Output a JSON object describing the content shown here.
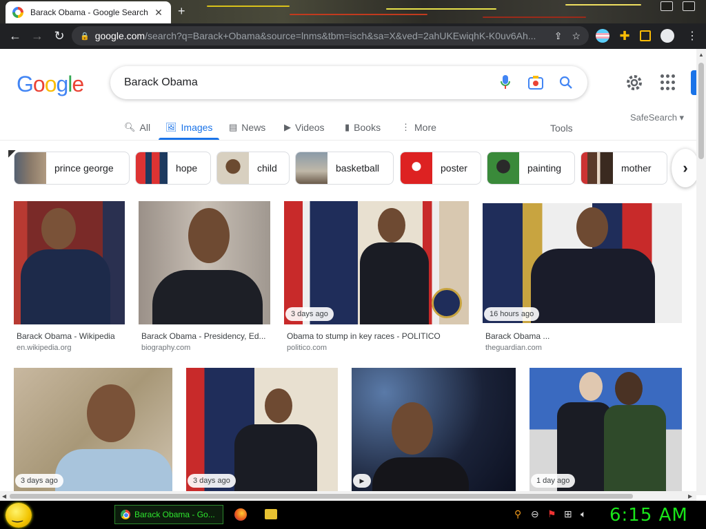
{
  "browser": {
    "tab_title": "Barack Obama - Google Search",
    "url_host": "google.com",
    "url_rest": "/search?q=Barack+Obama&source=lnms&tbm=isch&sa=X&ved=2ahUKEwiqhK-K0uv6Ah...",
    "tab_close": "✕",
    "new_tab": "+"
  },
  "google": {
    "logo": [
      "G",
      "o",
      "o",
      "g",
      "l",
      "e"
    ],
    "logo_colors": [
      "#4285f4",
      "#ea4335",
      "#fbbc05",
      "#4285f4",
      "#34a853",
      "#ea4335"
    ],
    "query": "Barack Obama",
    "tabs": [
      {
        "label": "All",
        "icon": "search-icon"
      },
      {
        "label": "Images",
        "icon": "image-icon",
        "active": true
      },
      {
        "label": "News",
        "icon": "news-icon"
      },
      {
        "label": "Videos",
        "icon": "video-icon"
      },
      {
        "label": "Books",
        "icon": "book-icon"
      },
      {
        "label": "More",
        "icon": "more-vert-icon"
      }
    ],
    "tools": "Tools",
    "safesearch": "SafeSearch ▾",
    "chips": [
      "prince george",
      "hope",
      "child",
      "basketball",
      "poster",
      "painting",
      "mother"
    ],
    "results": [
      {
        "title": "Barack Obama - Wikipedia",
        "source": "en.wikipedia.org",
        "badge": ""
      },
      {
        "title": "Barack Obama - Presidency, Ed...",
        "source": "biography.com",
        "badge": ""
      },
      {
        "title": "Obama to stump in key races - POLITICO",
        "source": "politico.com",
        "badge": "3 days ago"
      },
      {
        "title": "Barack Obama ...",
        "source": "theguardian.com",
        "badge": "16 hours ago"
      },
      {
        "title": "",
        "source": "",
        "badge": "3 days ago"
      },
      {
        "title": "",
        "source": "",
        "badge": "3 days ago"
      },
      {
        "title": "",
        "source": "",
        "badge": ""
      },
      {
        "title": "",
        "source": "",
        "badge": "1 day ago"
      }
    ]
  },
  "taskbar": {
    "task_label": "Barack Obama - Go...",
    "clock": "6:15 AM"
  },
  "colors": {
    "accent": "#1a73e8",
    "clock": "#19e619"
  }
}
